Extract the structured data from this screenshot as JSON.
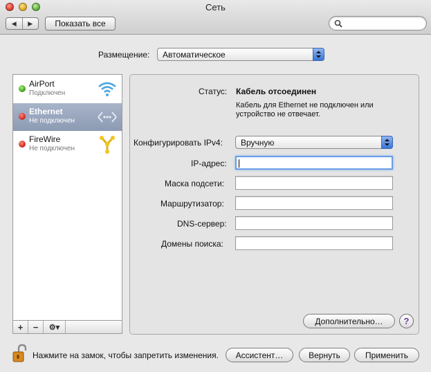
{
  "window": {
    "title": "Сеть"
  },
  "toolbar": {
    "back_glyph": "◀",
    "forward_glyph": "▶",
    "show_all_label": "Показать все",
    "search_placeholder": ""
  },
  "location": {
    "label": "Размещение:",
    "value": "Автоматическое"
  },
  "sidebar": {
    "items": [
      {
        "name": "AirPort",
        "status": "Подключен",
        "indicator": "green",
        "icon": "wifi-icon",
        "selected": false
      },
      {
        "name": "Ethernet",
        "status": "Не подключен",
        "indicator": "red",
        "icon": "ethernet-icon",
        "selected": true
      },
      {
        "name": "FireWire",
        "status": "Не подключен",
        "indicator": "red",
        "icon": "firewire-icon",
        "selected": false
      }
    ],
    "add_label": "+",
    "remove_label": "−",
    "action_label": "⚙▾"
  },
  "detail": {
    "status_label": "Статус:",
    "status_value": "Кабель отсоединен",
    "status_desc_line1": "Кабель для Ethernet не подключен или",
    "status_desc_line2": "устройство не отвечает.",
    "configure_label": "Конфигурировать IPv4:",
    "configure_value": "Вручную",
    "fields": [
      {
        "label": "IP-адрес:",
        "value": ""
      },
      {
        "label": "Маска подсети:",
        "value": ""
      },
      {
        "label": "Маршрутизатор:",
        "value": ""
      },
      {
        "label": "DNS-сервер:",
        "value": ""
      },
      {
        "label": "Домены поиска:",
        "value": ""
      }
    ],
    "advanced_label": "Дополнительно…",
    "help_label": "?"
  },
  "footer": {
    "lock_text": "Нажмите на замок, чтобы запретить изменения.",
    "assistant_label": "Ассистент…",
    "revert_label": "Вернуть",
    "apply_label": "Применить"
  },
  "colors": {
    "selection": "#8c9ab3",
    "accent_blue": "#3a74d7",
    "status_green": "#3a9a1a",
    "status_red": "#c8231a"
  }
}
